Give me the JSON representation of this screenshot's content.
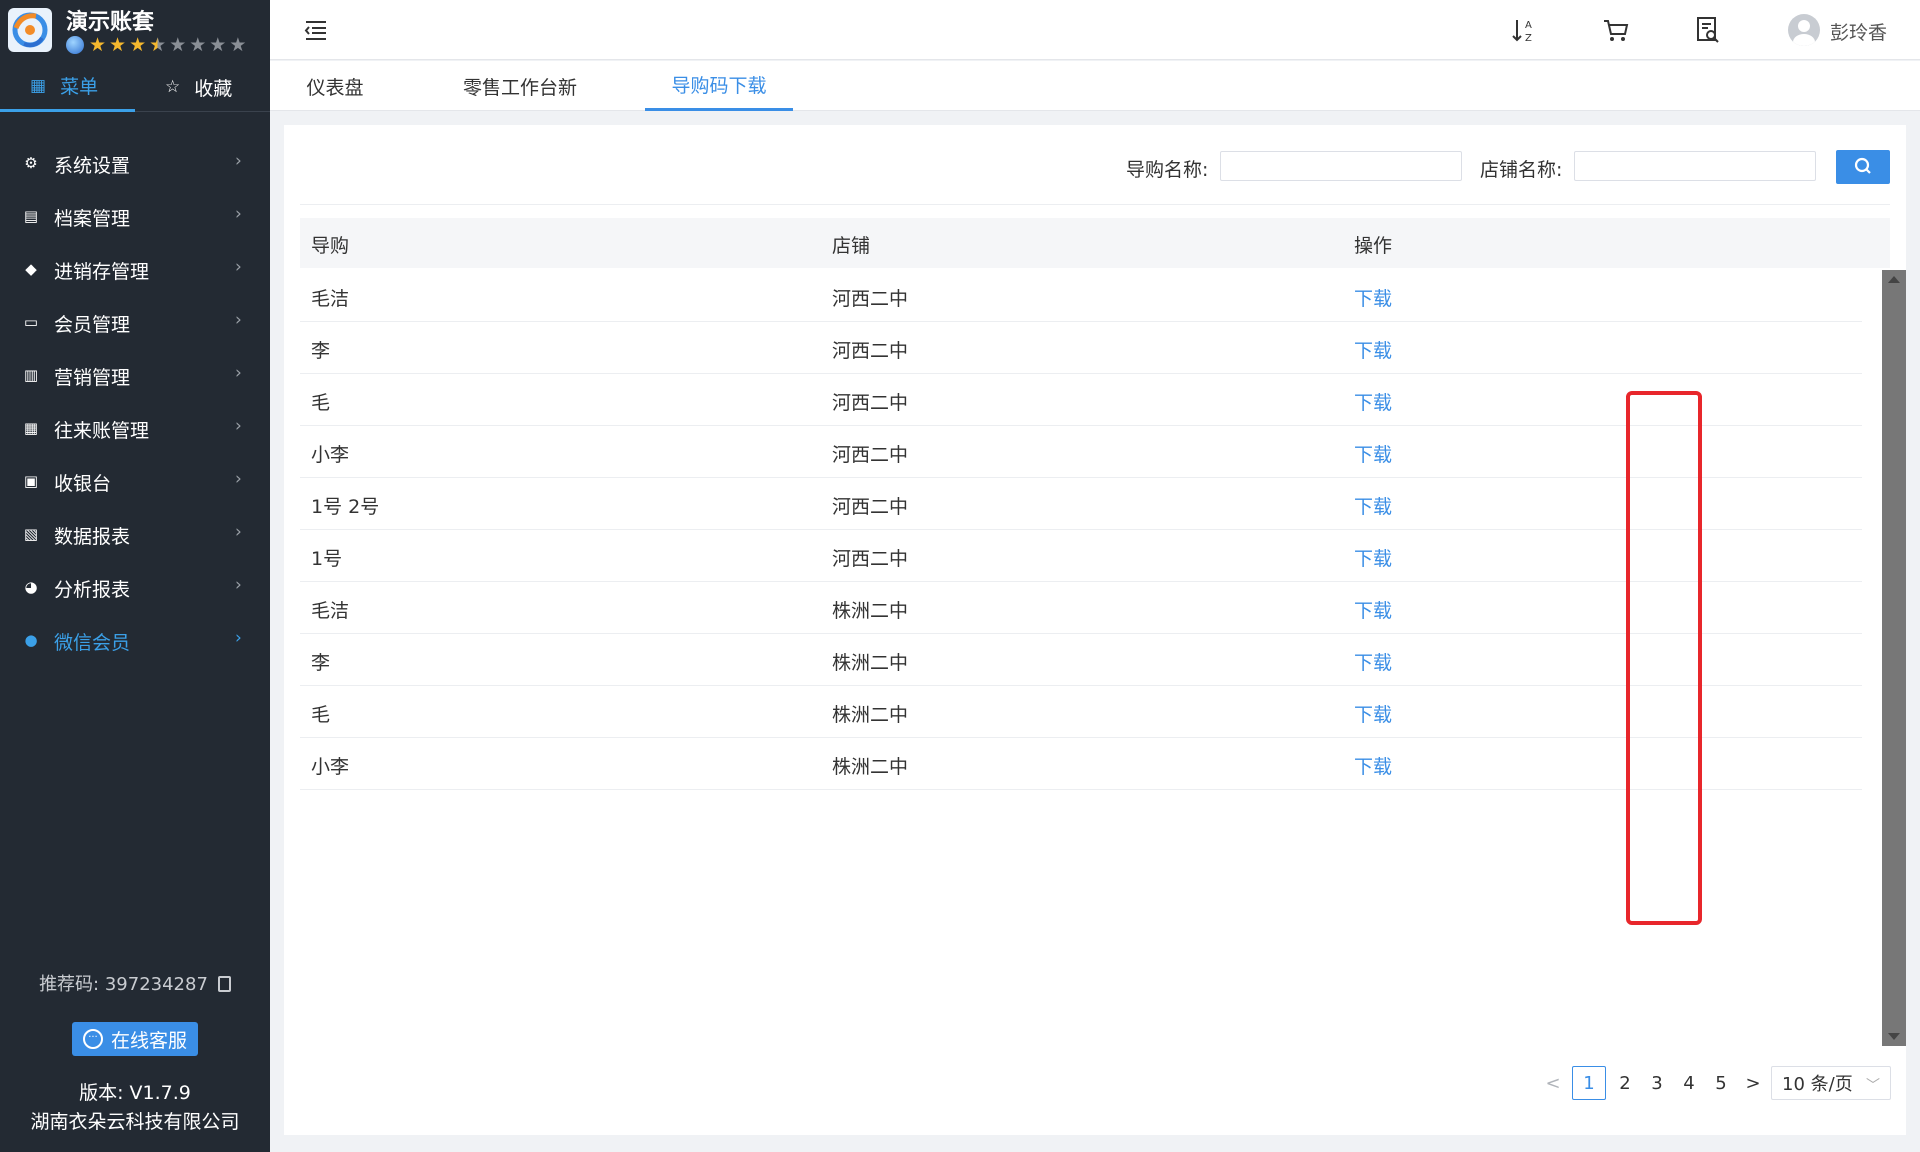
{
  "app": {
    "name": "演示账套",
    "rating": 3.5,
    "rating_max": 8
  },
  "side_tabs": {
    "menu": "菜单",
    "favorites": "收藏"
  },
  "nav": {
    "items": [
      {
        "label": "系统设置",
        "icon": "settings-icon"
      },
      {
        "label": "档案管理",
        "icon": "archive-icon"
      },
      {
        "label": "进销存管理",
        "icon": "box-icon"
      },
      {
        "label": "会员管理",
        "icon": "vip-card-icon"
      },
      {
        "label": "营销管理",
        "icon": "gift-icon"
      },
      {
        "label": "往来账管理",
        "icon": "calendar-icon"
      },
      {
        "label": "收银台",
        "icon": "chart-monitor-icon"
      },
      {
        "label": "数据报表",
        "icon": "report-icon"
      },
      {
        "label": "分析报表",
        "icon": "pie-icon"
      },
      {
        "label": "微信会员",
        "icon": "wechat-icon",
        "active": true
      }
    ]
  },
  "footer": {
    "ref_code": "推荐码: 397234287",
    "support": "在线客服",
    "version": "版本: V1.7.9",
    "company": "湖南衣朵云科技有限公司"
  },
  "header": {
    "user_name": "彭玲香"
  },
  "page_tabs": [
    "仪表盘",
    "零售工作台新",
    "导购码下载"
  ],
  "search": {
    "guide_label": "导购名称:",
    "guide_value": "",
    "store_label": "店铺名称:",
    "store_value": ""
  },
  "table": {
    "columns": [
      "导购",
      "店铺",
      "操作"
    ],
    "rows": [
      {
        "guide": "毛洁",
        "store": "河西二中",
        "action": "下载"
      },
      {
        "guide": "李",
        "store": "河西二中",
        "action": "下载"
      },
      {
        "guide": "毛",
        "store": "河西二中",
        "action": "下载"
      },
      {
        "guide": "小李",
        "store": "河西二中",
        "action": "下载"
      },
      {
        "guide": "1号 2号",
        "store": "河西二中",
        "action": "下载"
      },
      {
        "guide": "1号",
        "store": "河西二中",
        "action": "下载"
      },
      {
        "guide": "毛洁",
        "store": "株洲二中",
        "action": "下载"
      },
      {
        "guide": "李",
        "store": "株洲二中",
        "action": "下载"
      },
      {
        "guide": "毛",
        "store": "株洲二中",
        "action": "下载"
      },
      {
        "guide": "小李",
        "store": "株洲二中",
        "action": "下载"
      }
    ]
  },
  "pagination": {
    "prev": "<",
    "pages": [
      "1",
      "2",
      "3",
      "4",
      "5"
    ],
    "current": "1",
    "next": ">",
    "page_size": "10 条/页"
  },
  "colors": {
    "accent": "#3a8ee6",
    "sidebar_bg": "#232a33",
    "highlight_box": "#e8262b"
  }
}
